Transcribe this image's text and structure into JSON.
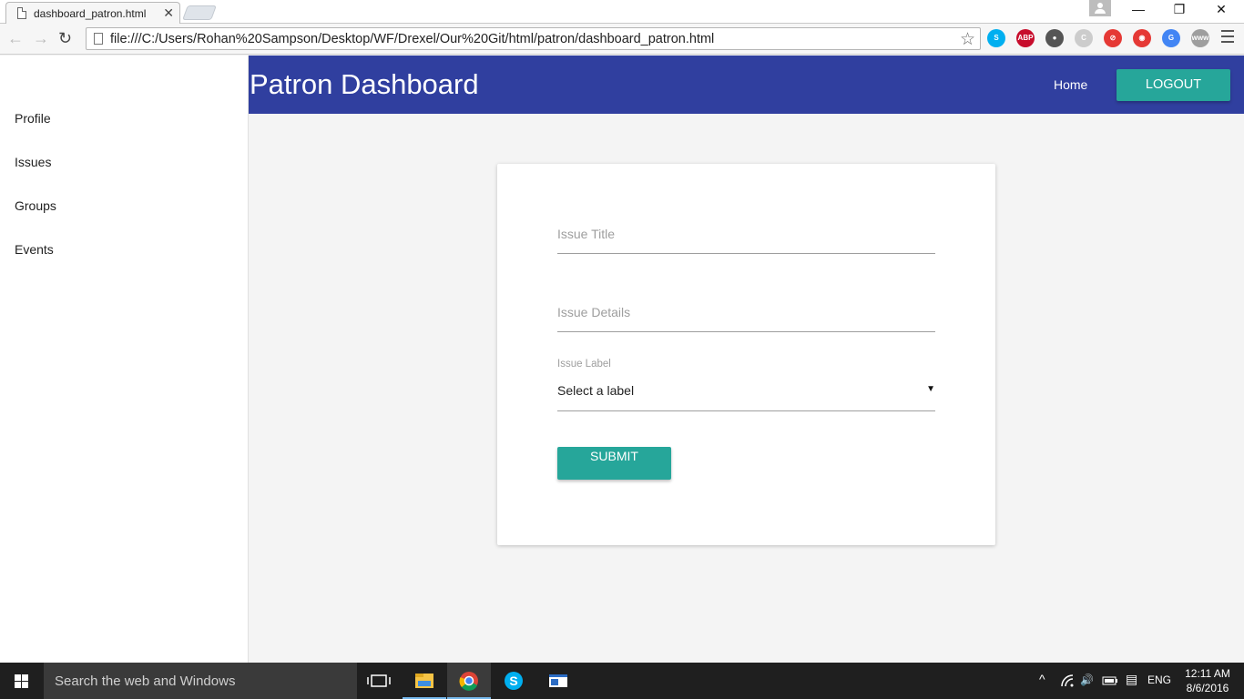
{
  "browser": {
    "tab_title": "dashboard_patron.html",
    "tab_close": "✕",
    "url": "file:///C:/Users/Rohan%20Sampson/Desktop/WF/Drexel/Our%20Git/html/patron/dashboard_patron.html",
    "back": "←",
    "forward": "→",
    "reload": "↻",
    "star": "☆",
    "minimize": "—",
    "restore": "❐",
    "close": "✕"
  },
  "extensions": [
    {
      "name": "skype",
      "glyph": "S",
      "color": "#00aff0"
    },
    {
      "name": "adblock",
      "glyph": "ABP",
      "color": "#c70d2c"
    },
    {
      "name": "bulb",
      "glyph": "●",
      "color": "#555555"
    },
    {
      "name": "refresh-ext",
      "glyph": "C",
      "color": "#cccccc"
    },
    {
      "name": "no-flash",
      "glyph": "⊘",
      "color": "#e53935"
    },
    {
      "name": "record",
      "glyph": "◉",
      "color": "#e53935"
    },
    {
      "name": "translate",
      "glyph": "G",
      "color": "#4285f4"
    },
    {
      "name": "www",
      "glyph": "www",
      "color": "#9e9e9e"
    }
  ],
  "sidebar": {
    "items": [
      {
        "label": "Profile"
      },
      {
        "label": "Issues"
      },
      {
        "label": "Groups"
      },
      {
        "label": "Events"
      }
    ]
  },
  "header": {
    "title": "Patron Dashboard",
    "home": "Home",
    "logout": "LOGOUT",
    "bg_color": "#303f9f",
    "accent_color": "#26a69a"
  },
  "form": {
    "issue_title_placeholder": "Issue Title",
    "issue_details_placeholder": "Issue Details",
    "issue_label_caption": "Issue Label",
    "issue_label_value": "Select a label",
    "caret": "▼",
    "submit": "SUBMIT"
  },
  "taskbar": {
    "search_placeholder": "Search the web and Windows",
    "lang": "ENG",
    "time": "12:11 AM",
    "date": "8/6/2016",
    "tray_chevron": "^",
    "volume": "🔊",
    "notification": "▤"
  }
}
